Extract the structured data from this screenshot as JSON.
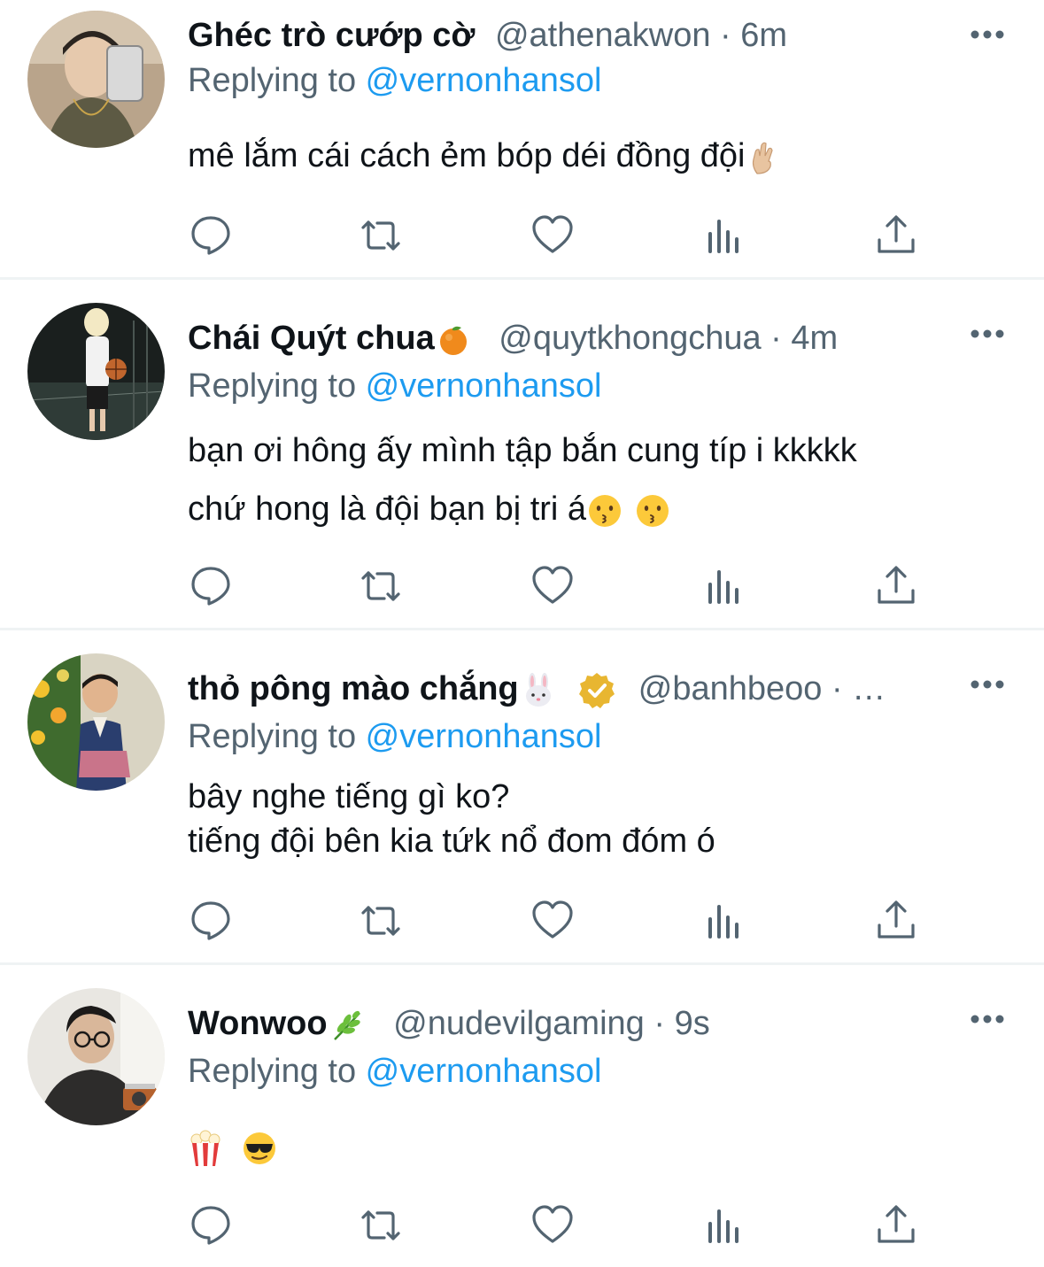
{
  "colors": {
    "text_primary": "#0f1419",
    "text_secondary": "#536471",
    "accent_blue": "#1d9bf0",
    "icon_gray": "#536471",
    "divider": "#eff3f4",
    "verified_badge": "#e8b631"
  },
  "icons": {
    "more": "more-horizontal-icon",
    "reply": "speech-bubble-icon",
    "retweet": "retweet-arrows-icon",
    "like": "heart-outline-icon",
    "views": "bar-chart-icon",
    "share": "share-upload-icon"
  },
  "replies": [
    {
      "display_name": "Ghéc trò cướp cờ",
      "name_emoji": "",
      "verified": false,
      "handle": "@athenakwon",
      "separator": " · ",
      "time": "6m",
      "replying_prefix": "Replying to ",
      "replying_to": "@vernonhansol",
      "lines": [
        "mê lắm cái cách ẻm bóp déi đồng đội"
      ],
      "trailing_emoji": "crossed-fingers"
    },
    {
      "display_name": "Chái Quýt chua",
      "name_emoji": "tangerine",
      "verified": false,
      "handle": "@quytkhongchua",
      "separator": " · ",
      "time": "4m",
      "replying_prefix": "Replying to ",
      "replying_to": "@vernonhansol",
      "lines": [
        "bạn ơi hông ấy mình tập bắn cung típ i kkkkk",
        "chứ hong là đội bạn bị tri á"
      ],
      "trailing_emoji": "kissing-face kissing-face"
    },
    {
      "display_name": "thỏ pông mào chắng",
      "name_emoji": "rabbit-face",
      "verified": true,
      "handle": "@banhbeoo",
      "separator": " · ",
      "time": "…",
      "replying_prefix": "Replying to ",
      "replying_to": "@vernonhansol",
      "lines": [
        "bây nghe tiếng gì ko?",
        "tiếng đội bên kia tứk nổ đom đóm ó"
      ],
      "trailing_emoji": ""
    },
    {
      "display_name": "Wonwoo",
      "name_emoji": "herb",
      "verified": false,
      "handle": "@nudevilgaming",
      "separator": " · ",
      "time": "9s",
      "replying_prefix": "Replying to ",
      "replying_to": "@vernonhansol",
      "lines": [
        ""
      ],
      "trailing_emoji": "popcorn sunglasses-face"
    }
  ]
}
